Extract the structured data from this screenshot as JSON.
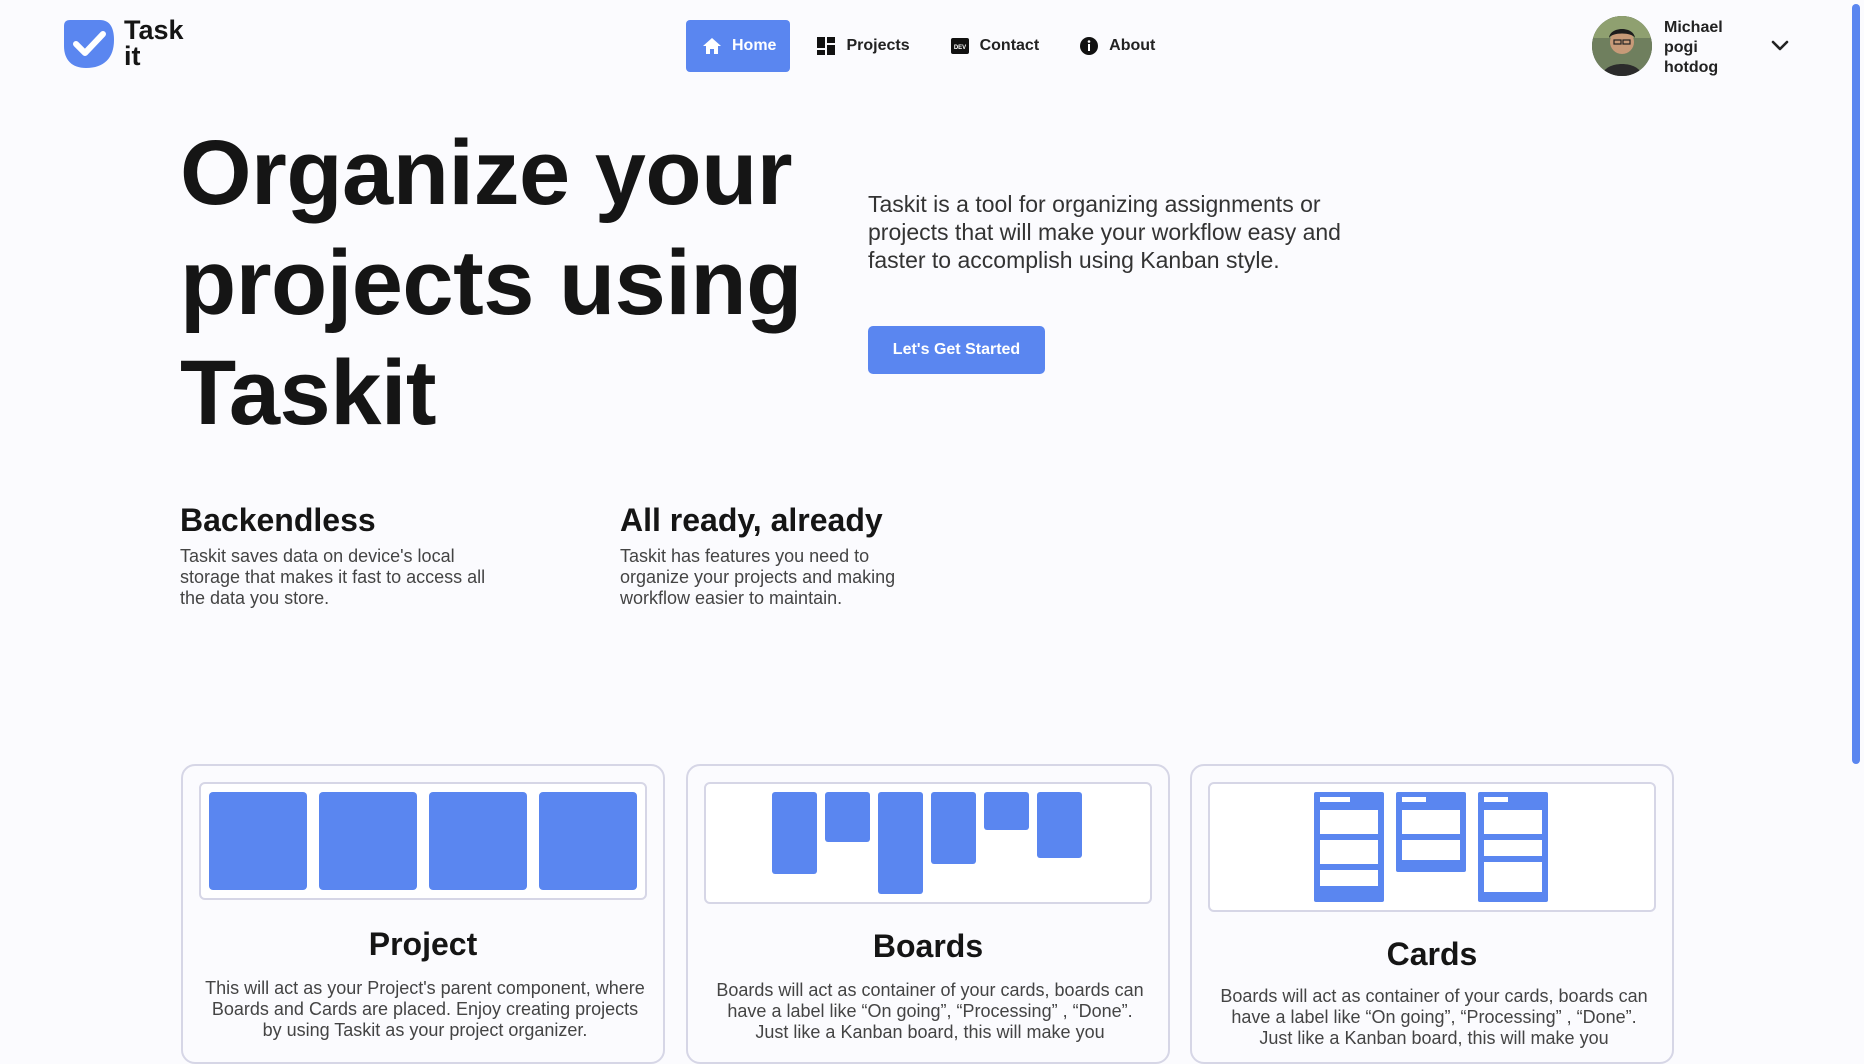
{
  "brand": {
    "name_line1": "Task",
    "name_line2": "it",
    "accent_color": "#5a86f0"
  },
  "nav": {
    "items": [
      {
        "label": "Home",
        "icon": "home-icon",
        "active": true
      },
      {
        "label": "Projects",
        "icon": "grid-icon",
        "active": false
      },
      {
        "label": "Contact",
        "icon": "dev-icon",
        "active": false
      },
      {
        "label": "About",
        "icon": "info-icon",
        "active": false
      }
    ]
  },
  "user": {
    "name_line1": "Michael",
    "name_line2": "pogi",
    "name_line3": "hotdog",
    "menu_icon": "chevron-down-icon"
  },
  "hero": {
    "title": "Organize your projects using Taskit",
    "description": "Taskit is a tool for organizing assignments or projects that will make your workflow easy and faster to accomplish using Kanban style.",
    "cta_label": "Let's Get Started"
  },
  "features": [
    {
      "title": "Backendless",
      "text": "Taskit saves data on device's local storage that makes it fast to access all the data you store."
    },
    {
      "title": "All ready, already",
      "text": "Taskit has features you need to organize your projects and making workflow easier to maintain."
    }
  ],
  "cards": [
    {
      "title": "Project",
      "text": "This will act as your Project's parent component, where Boards and Cards are placed. Enjoy creating projects by using Taskit as your project organizer."
    },
    {
      "title": "Boards",
      "text": "Boards will act as container of your cards, boards can have a label like “On going”, “Processing” , “Done”. Just like a Kanban board, this will make you"
    },
    {
      "title": "Cards",
      "text": "Boards will act as container of your cards, boards can have a label like “On going”, “Processing” , “Done”. Just like a Kanban board, this will make you"
    }
  ]
}
